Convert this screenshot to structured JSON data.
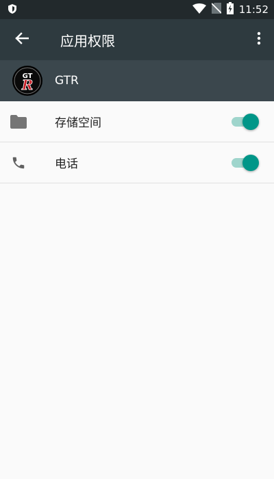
{
  "status_bar": {
    "time": "11:52",
    "icons": [
      "shield-icon",
      "wifi-icon",
      "no-sim-icon",
      "battery-charging-icon"
    ]
  },
  "app_bar": {
    "title": "应用权限",
    "back_icon": "arrow-back-icon",
    "menu_icon": "more-vert-icon"
  },
  "app_info": {
    "name": "GTR",
    "logo_text": "GTR"
  },
  "permissions": [
    {
      "label": "存储空间",
      "icon": "folder-icon",
      "enabled": true
    },
    {
      "label": "电话",
      "icon": "phone-icon",
      "enabled": true
    }
  ],
  "colors": {
    "status_bar": "#22292c",
    "app_bar": "#2e3a3f",
    "app_info": "#3b474d",
    "accent": "#009688",
    "track": "#9fd5cc"
  }
}
